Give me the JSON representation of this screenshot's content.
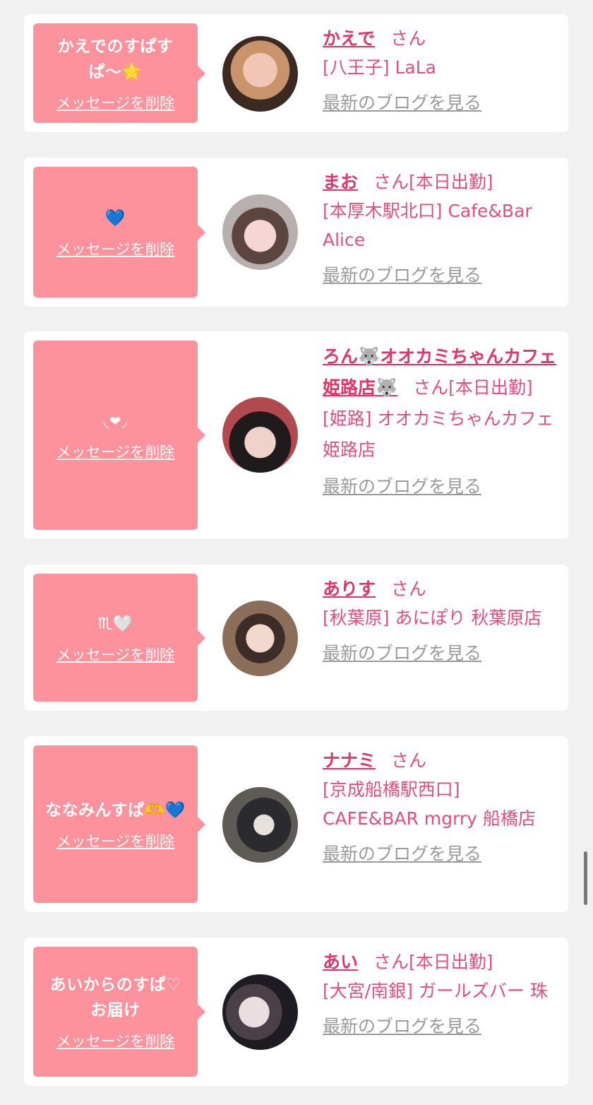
{
  "items": [
    {
      "message": "かえでのすぱすぱ〜🌟",
      "delete_label": "メッセージを削除",
      "name": "かえで",
      "honorific": "さん",
      "status": "",
      "shop": "[八王子] LaLa",
      "blog_label": "最新のブログを見る"
    },
    {
      "message": "💙",
      "delete_label": "メッセージを削除",
      "name": "まお",
      "honorific": "さん",
      "status": "[本日出勤]",
      "shop": "[本厚木駅北口] Cafe&Bar Alice",
      "blog_label": "最新のブログを見る"
    },
    {
      "message": "◟❤︎◞",
      "delete_label": "メッセージを削除",
      "name": "ろん🐺オオカミちゃんカフェ姫路店🐺",
      "honorific": "さん",
      "status": "[本日出勤]",
      "shop": "[姫路] オオカミちゃんカフェ姫路店",
      "blog_label": "最新のブログを見る"
    },
    {
      "message": "♏🤍",
      "delete_label": "メッセージを削除",
      "name": "ありす",
      "honorific": "さん",
      "status": "",
      "shop": "[秋葉原] あにぽり 秋葉原店",
      "blog_label": "最新のブログを見る"
    },
    {
      "message": "ななみんすぱ🫶💙",
      "delete_label": "メッセージを削除",
      "name": "ナナミ",
      "honorific": "さん",
      "status": "",
      "shop": "[京成船橋駅西口] CAFE&BAR mgrry 船橋店",
      "blog_label": "最新のブログを見る"
    },
    {
      "message": "あいからのすぱ♡お届け",
      "delete_label": "メッセージを削除",
      "name": "あい",
      "honorific": "さん",
      "status": "[本日出勤]",
      "shop": "[大宮/南銀] ガールズバー 珠",
      "blog_label": "最新のブログを見る"
    }
  ],
  "colors": {
    "accent": "#e0376b",
    "bubble": "#fd929c",
    "background": "#f1f1f1"
  }
}
